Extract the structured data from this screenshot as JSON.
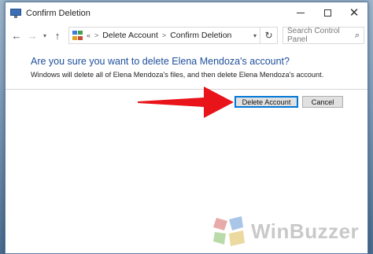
{
  "window": {
    "title": "Confirm Deletion",
    "controls": {
      "minimize": "—",
      "maximize": "☐",
      "close": "✕"
    }
  },
  "nav": {
    "back_icon": "arrow-left-icon",
    "forward_icon": "arrow-right-icon",
    "up_icon": "arrow-up-icon",
    "breadcrumb_overflow": "«",
    "breadcrumbs": [
      "Delete Account",
      "Confirm Deletion"
    ],
    "breadcrumb_separator": ">",
    "search_placeholder": "Search Control Panel"
  },
  "dialog": {
    "heading": "Are you sure you want to delete Elena Mendoza's account?",
    "subtext": "Windows will delete all of Elena Mendoza's files, and then delete Elena Mendoza's account.",
    "primary_button": "Delete Account",
    "cancel_button": "Cancel"
  },
  "annotation": {
    "arrow_color": "#e8141a"
  },
  "watermark": {
    "text": "WinBuzzer"
  },
  "colors": {
    "heading": "#1e4f9a",
    "accent": "#0078d7"
  }
}
